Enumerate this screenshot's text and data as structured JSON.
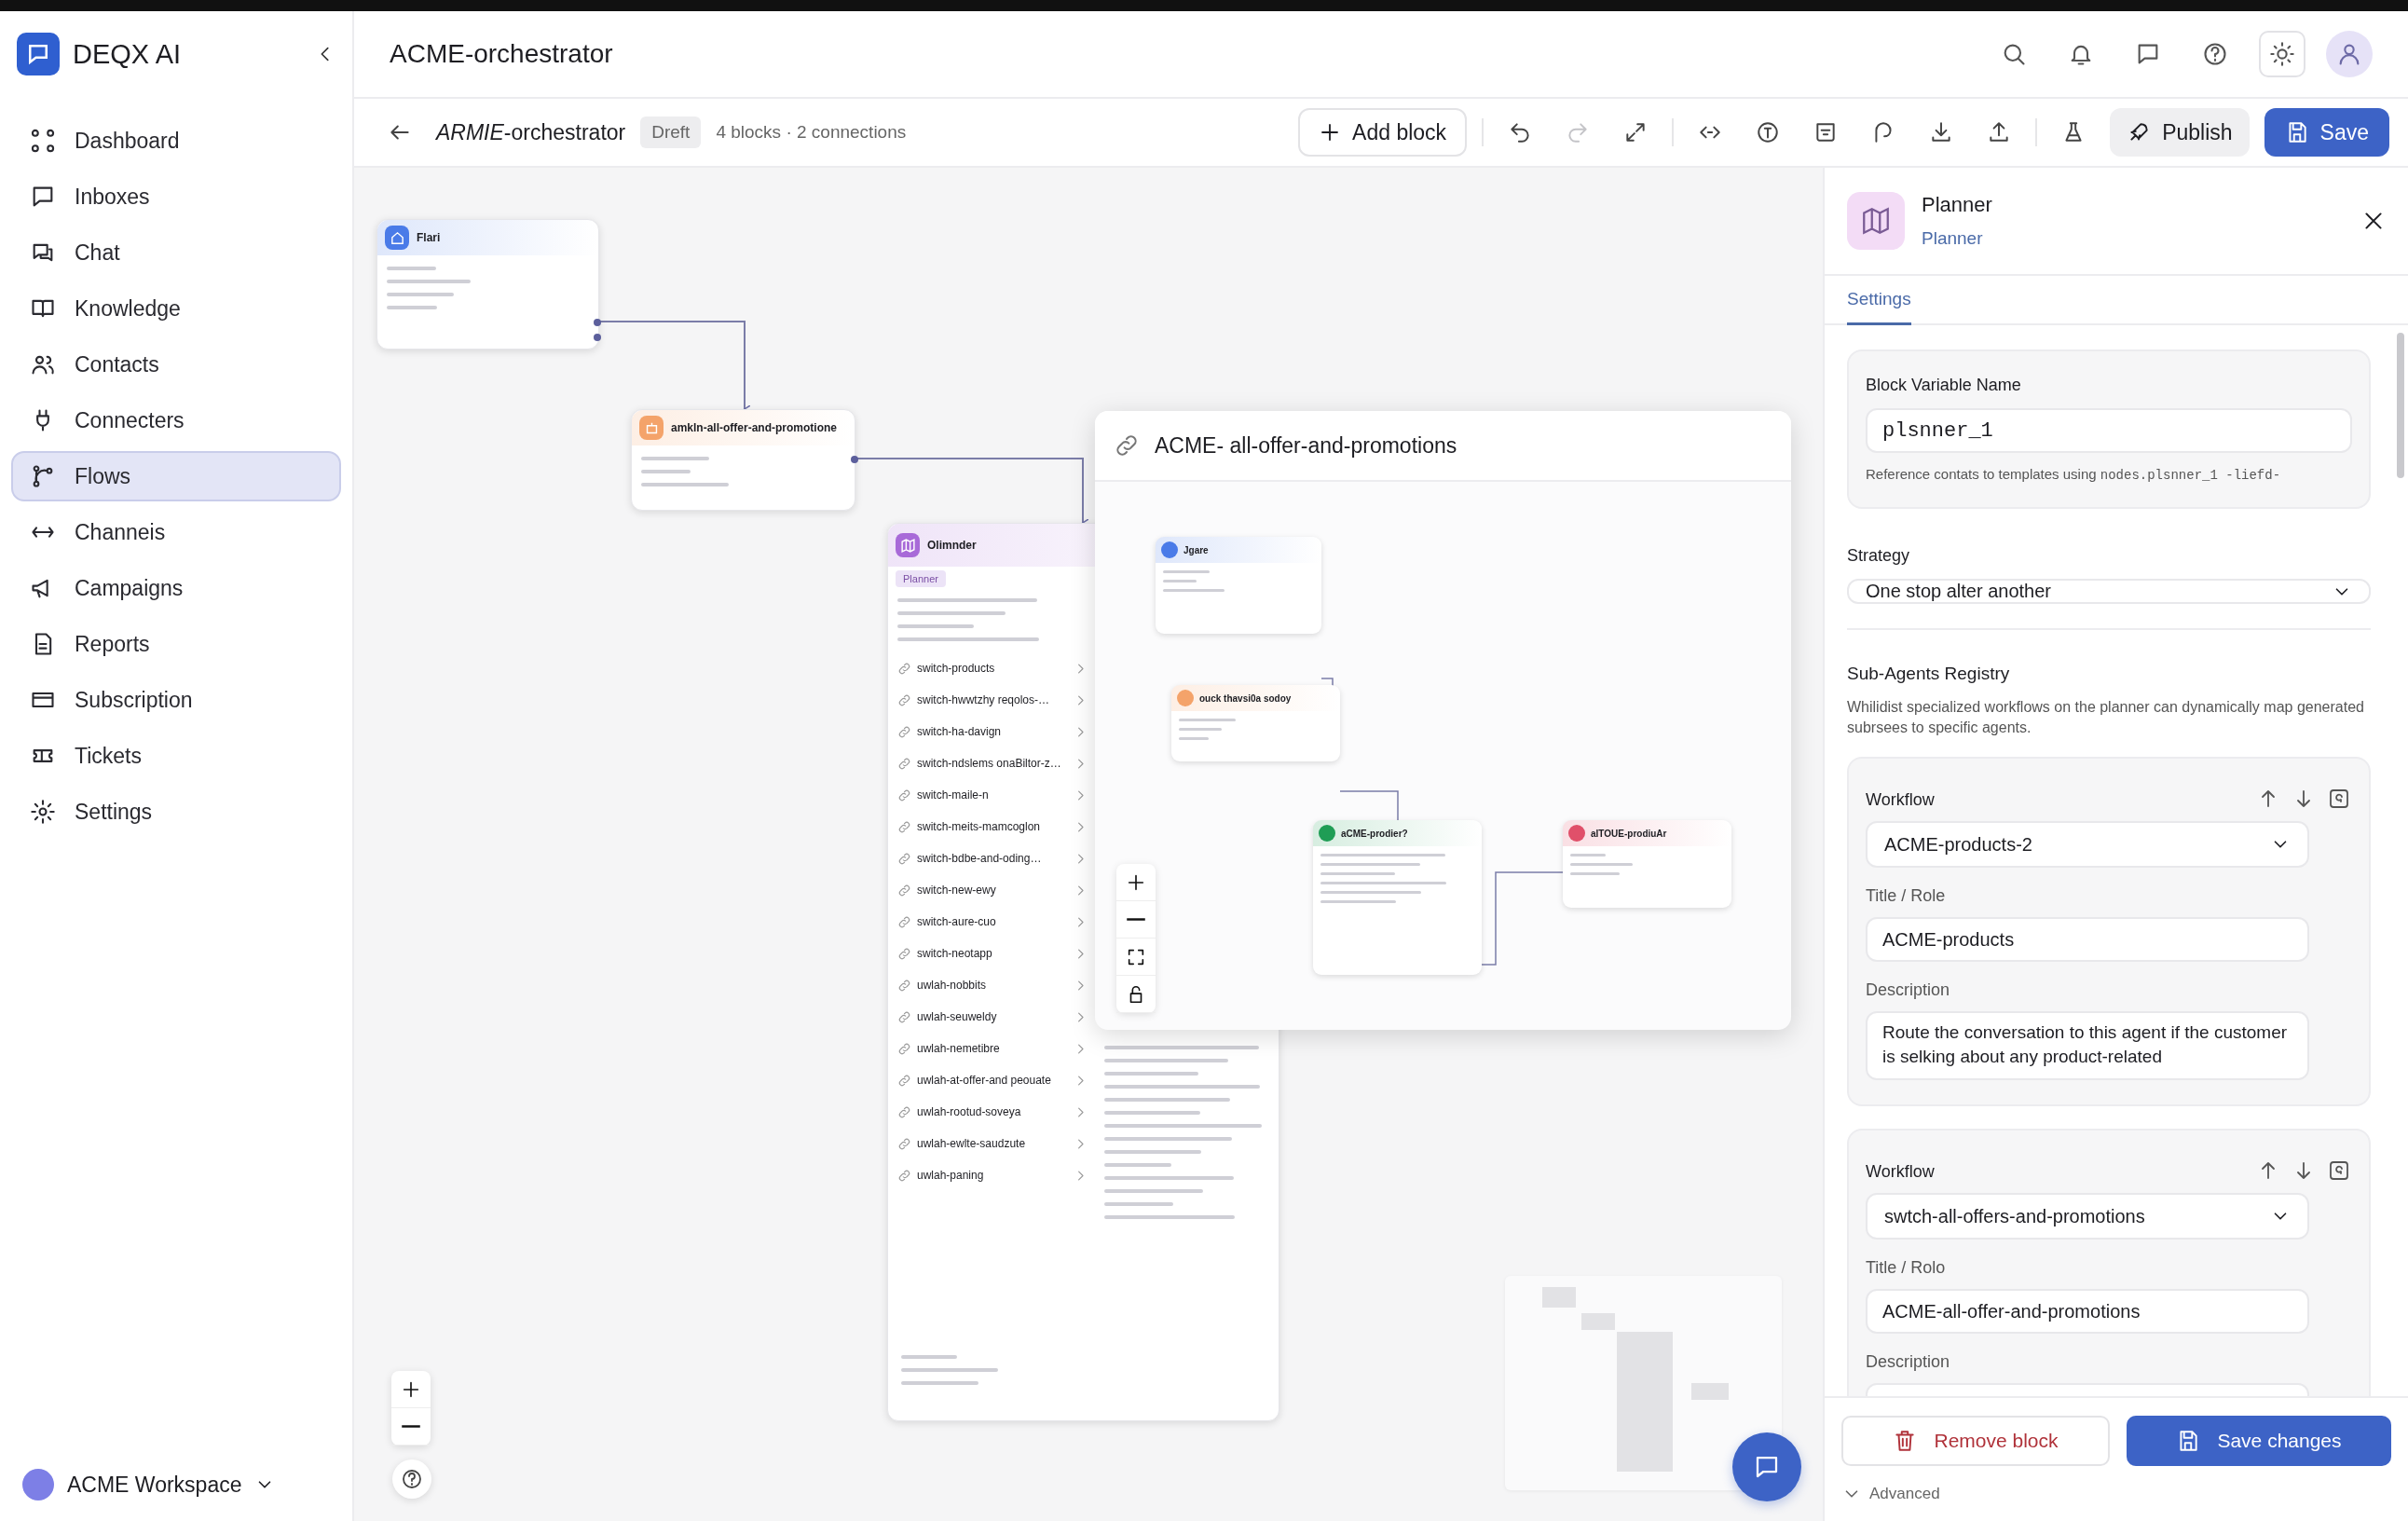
{
  "app": {
    "name": "DEQX AI"
  },
  "sidebar": {
    "items": [
      {
        "label": "Dashboard",
        "selected": false
      },
      {
        "label": "Inboxes",
        "selected": false
      },
      {
        "label": "Chat",
        "selected": false
      },
      {
        "label": "Knowledge",
        "selected": false
      },
      {
        "label": "Contacts",
        "selected": false
      },
      {
        "label": "Connecters",
        "selected": false
      },
      {
        "label": "Flows",
        "selected": true
      },
      {
        "label": "Channeis",
        "selected": false
      },
      {
        "label": "Campaigns",
        "selected": false
      },
      {
        "label": "Reports",
        "selected": false
      },
      {
        "label": "Subscription",
        "selected": false
      },
      {
        "label": "Tickets",
        "selected": false
      },
      {
        "label": "Settings",
        "selected": false
      }
    ],
    "workspace": "ACME Workspace"
  },
  "header": {
    "title": "ACME-orchestrator"
  },
  "toolbar": {
    "flow_name": "*ARMIE*-orchestrator",
    "status": "Dreft",
    "summary": "4 blocks · 2 connections",
    "add_label": "Add block",
    "tools": [
      {
        "kind": "undo",
        "disabled": false
      },
      {
        "kind": "redo",
        "disabled": true
      },
      {
        "kind": "expand",
        "disabled": false
      },
      {
        "kind": "code",
        "disabled": false
      },
      {
        "kind": "variable",
        "disabled": false
      },
      {
        "kind": "filter",
        "disabled": false
      },
      {
        "kind": "hook",
        "disabled": false
      },
      {
        "kind": "download",
        "disabled": false
      },
      {
        "kind": "upload",
        "disabled": false
      },
      {
        "kind": "test",
        "disabled": false
      }
    ],
    "publish_label": "Publish",
    "save_label": "Save"
  },
  "canvas": {
    "nodes": [
      {
        "kind": "start",
        "title": "Flari",
        "color": "#4a7be8"
      },
      {
        "kind": "action",
        "title": "amkln-all-offer-and-promotione",
        "color": "#f4a36a"
      },
      {
        "kind": "planner",
        "title": "Olimnder",
        "tag": "Planner",
        "color": "#a86ad8",
        "items": [
          "switch-products",
          "switch-hwwtzhy reqolos-…",
          "switch-ha-davign",
          "switch-ndslems onaBiltor-z…",
          "switch-maile-n",
          "switch-meits-mamcoglon",
          "switch-bdbe-and-oding…",
          "switch-new-ewy",
          "switch-aure-cuo",
          "switch-neotapp",
          "uwlah-nobbits",
          "uwlah-seuweldy",
          "uwlah-nemetibre",
          "uwlah-at-offer-and peouate",
          "uwlah-rootud-soveya",
          "uwlah-ewlte-saudzute",
          "uwlah-paning"
        ]
      }
    ],
    "popup": {
      "title": "ACME- all-offer-and-promotions",
      "nodes": [
        {
          "title": "Jgare",
          "color": "#4a7be8"
        },
        {
          "title": "ouck thavsi0a sodoy",
          "color": "#f4a36a"
        },
        {
          "title": "aCME-prodier?",
          "color": "#1f9d55"
        },
        {
          "title": "aITOUE-prodiuAr",
          "color": "#e0506a"
        }
      ]
    }
  },
  "panel": {
    "title": "Planner",
    "subtitle": "Planner",
    "tabs": [
      {
        "label": "Settings",
        "selected": true
      }
    ],
    "variable": {
      "label": "Block Variable Name",
      "value": "plsnner_1",
      "hint": "Reference contats to templates using",
      "code": "nodes.plsnner_1 -liefd-"
    },
    "strategy": {
      "label": "Strategy",
      "value": "One stop alter another"
    },
    "registry": {
      "title": "Sub-Agents Registry",
      "description": "Whilidist specialized workflows on the planner can dynamically map generated subrsees to specific agents."
    },
    "agents": [
      {
        "workflow_label": "Workflow",
        "workflow": "ACME-products-2",
        "title_label": "Title / Role",
        "title": "ACME-products",
        "description_label": "Description",
        "description": "Route the conversation to this agent if the customer is selking about any product-related"
      },
      {
        "workflow_label": "Workflow",
        "workflow": "swtch-all-offers-and-promotions",
        "title_label": "Title / Rolo",
        "title": "ACME-all-offer-and-promotions",
        "description_label": "Description"
      }
    ],
    "remove_label": "Remove block",
    "save_label": "Save changes",
    "advanced_label": "Advanced"
  }
}
